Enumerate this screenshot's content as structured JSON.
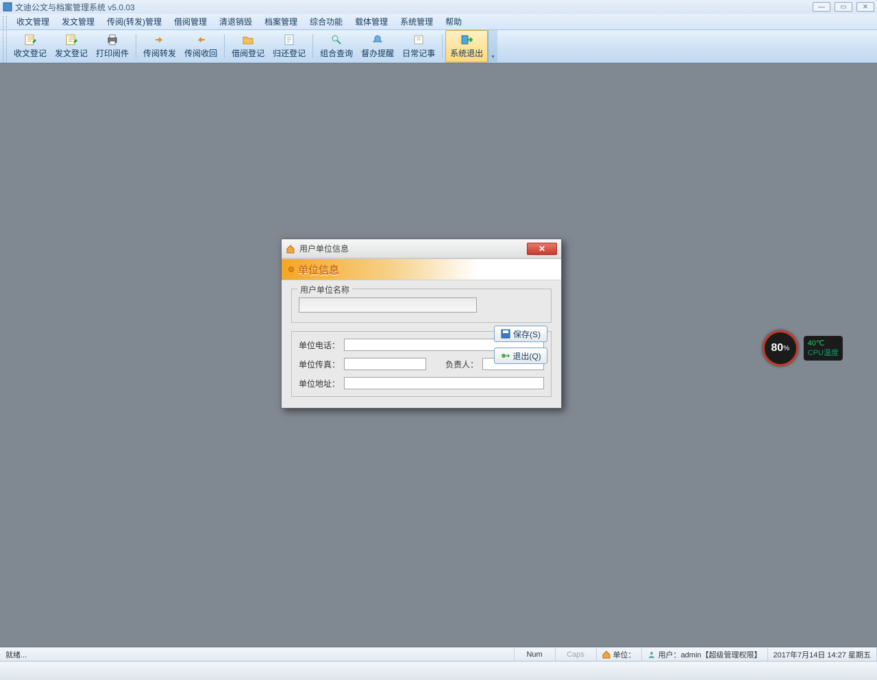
{
  "window": {
    "title": "文迪公文与档案管理系统 v5.0.03"
  },
  "menu": [
    "收文管理",
    "发文管理",
    "传阅(转发)管理",
    "借阅管理",
    "清退销毁",
    "档案管理",
    "综合功能",
    "载体管理",
    "系统管理",
    "帮助"
  ],
  "toolbar": {
    "items": [
      {
        "label": "收文登记",
        "icon": "doc-pencil"
      },
      {
        "label": "发文登记",
        "icon": "doc-pencil"
      },
      {
        "label": "打印阅件",
        "icon": "print"
      },
      {
        "sep": true
      },
      {
        "label": "传阅转发",
        "icon": "arrow-right"
      },
      {
        "label": "传阅收回",
        "icon": "arrow-left"
      },
      {
        "sep": true
      },
      {
        "label": "借阅登记",
        "icon": "folder"
      },
      {
        "label": "归还登记",
        "icon": "doc"
      },
      {
        "sep": true
      },
      {
        "label": "组合查询",
        "icon": "search"
      },
      {
        "label": "督办提醒",
        "icon": "bell"
      },
      {
        "label": "日常记事",
        "icon": "note"
      },
      {
        "sep": true
      },
      {
        "label": "系统退出",
        "icon": "exit",
        "active": true
      }
    ]
  },
  "dialog": {
    "title": "用户单位信息",
    "section": "单位信息",
    "name_legend": "用户单位名称",
    "name_value": "",
    "save": "保存(S)",
    "exit": "退出(Q)",
    "phone_label": "单位电话：",
    "phone": "",
    "fax_label": "单位传真：",
    "fax": "",
    "owner_label": "负责人：",
    "owner": "",
    "addr_label": "单位地址：",
    "addr": ""
  },
  "status": {
    "ready": "就绪...",
    "num": "Num",
    "caps": "Caps",
    "org_label": "单位：",
    "org_value": "",
    "user_label": "用户：",
    "user_value": "admin【超级管理权限】",
    "datetime": "2017年7月14日 14:27 星期五"
  },
  "cpu": {
    "pct": "80",
    "pct_suffix": "%",
    "temp": "40℃",
    "label": "CPU温度"
  }
}
